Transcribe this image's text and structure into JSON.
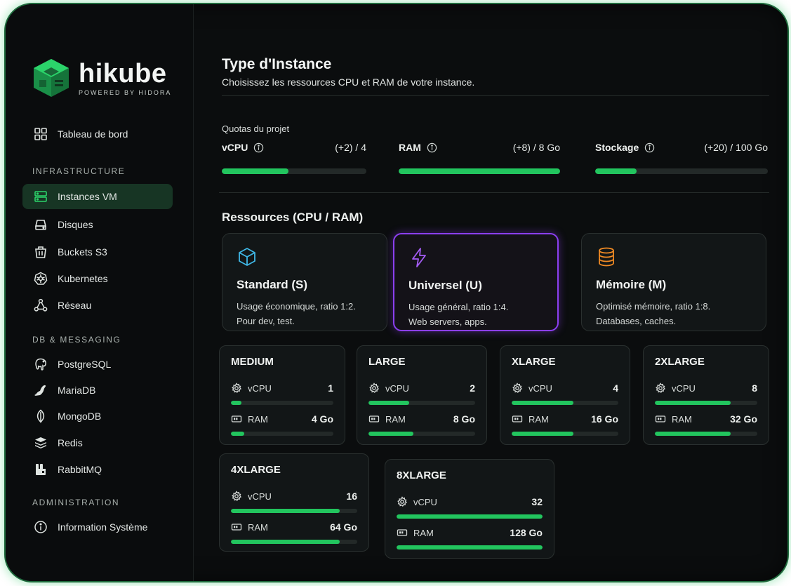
{
  "brand": {
    "name": "hikube",
    "tagline": "POWERED BY HIDORA",
    "accent": "#22c55e",
    "selected_color": "#8b3ff0"
  },
  "sidebar": {
    "dashboard": {
      "label": "Tableau de bord",
      "icon": "grid-icon"
    },
    "sections": [
      {
        "title": "INFRASTRUCTURE"
      },
      {
        "title": "DB & MESSAGING"
      },
      {
        "title": "ADMINISTRATION"
      }
    ],
    "infrastructure": [
      {
        "label": "Instances VM",
        "icon": "server-icon",
        "active": true
      },
      {
        "label": "Disques",
        "icon": "disk-icon"
      },
      {
        "label": "Buckets S3",
        "icon": "bucket-icon"
      },
      {
        "label": "Kubernetes",
        "icon": "kubernetes-icon"
      },
      {
        "label": "Réseau",
        "icon": "network-icon"
      }
    ],
    "db": [
      {
        "label": "PostgreSQL",
        "icon": "elephant-icon"
      },
      {
        "label": "MariaDB",
        "icon": "seal-icon"
      },
      {
        "label": "MongoDB",
        "icon": "leaf-icon"
      },
      {
        "label": "Redis",
        "icon": "layers-icon"
      },
      {
        "label": "RabbitMQ",
        "icon": "rabbit-icon"
      }
    ],
    "admin": [
      {
        "label": "Information Système",
        "icon": "info-icon"
      }
    ]
  },
  "main": {
    "title": "Type d'Instance",
    "subtitle": "Choisissez les ressources CPU et RAM de votre instance.",
    "quotas": {
      "title": "Quotas du projet",
      "items": [
        {
          "label": "vCPU",
          "value": "(+2) / 4",
          "fill": 0.46
        },
        {
          "label": "RAM",
          "value": "(+8) / 8 Go",
          "fill": 1.0
        },
        {
          "label": "Stockage",
          "value": "(+20) / 100 Go",
          "fill": 0.24
        }
      ]
    },
    "resources_title": "Ressources (CPU / RAM)",
    "families": [
      {
        "name": "Standard (S)",
        "desc1": "Usage économique, ratio 1:2.",
        "desc2": "Pour dev, test.",
        "icon": "cube-icon",
        "selected": false
      },
      {
        "name": "Universel (U)",
        "desc1": "Usage général, ratio 1:4.",
        "desc2": "Web servers, apps.",
        "icon": "lightning-icon",
        "selected": true
      },
      {
        "name": "Mémoire (M)",
        "desc1": "Optimisé mémoire, ratio 1:8.",
        "desc2": "Databases, caches.",
        "icon": "database-icon",
        "selected": false
      }
    ],
    "cpu_label": "vCPU",
    "ram_label": "RAM",
    "sizes": [
      {
        "name": "MEDIUM",
        "vcpu": "1",
        "ram": "4 Go",
        "cpu_fill": 0.1,
        "ram_fill": 0.13
      },
      {
        "name": "LARGE",
        "vcpu": "2",
        "ram": "8 Go",
        "cpu_fill": 0.38,
        "ram_fill": 0.42
      },
      {
        "name": "XLARGE",
        "vcpu": "4",
        "ram": "16 Go",
        "cpu_fill": 0.58,
        "ram_fill": 0.58
      },
      {
        "name": "2XLARGE",
        "vcpu": "8",
        "ram": "32 Go",
        "cpu_fill": 0.74,
        "ram_fill": 0.74
      },
      {
        "name": "4XLARGE",
        "vcpu": "16",
        "ram": "64 Go",
        "cpu_fill": 0.86,
        "ram_fill": 0.86
      },
      {
        "name": "8XLARGE",
        "vcpu": "32",
        "ram": "128 Go",
        "cpu_fill": 1.0,
        "ram_fill": 1.0
      }
    ]
  }
}
